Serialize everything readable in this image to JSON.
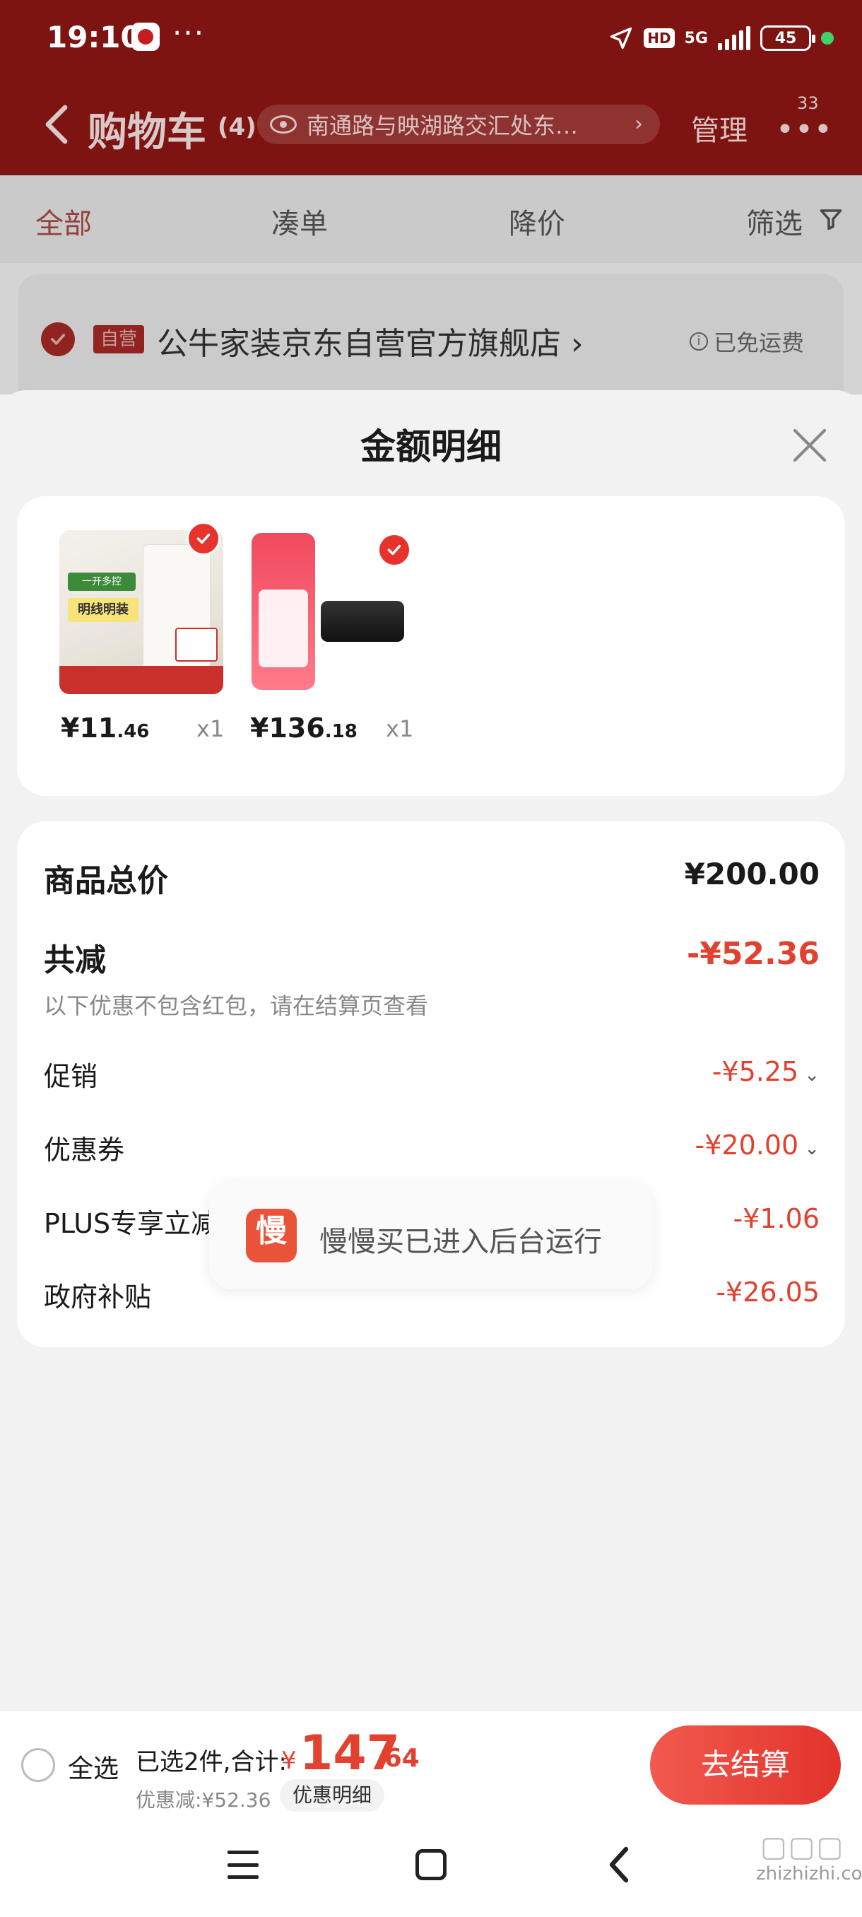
{
  "status_bar": {
    "time": "19:10",
    "dots": "···",
    "hd": "HD",
    "network": "5G",
    "battery": "45"
  },
  "header": {
    "title": "购物车",
    "count": "(4)",
    "address": "南通路与映湖路交汇处东…",
    "manage": "管理",
    "more_badge": "33"
  },
  "tabs": [
    {
      "label": "全部"
    },
    {
      "label": "凑单"
    },
    {
      "label": "降价"
    },
    {
      "label": "筛选"
    }
  ],
  "store": {
    "tag": "自营",
    "name": "公牛家装京东自营官方旗舰店 ›",
    "shipping": "已免运费"
  },
  "sheet": {
    "title": "金额明细",
    "products": [
      {
        "price_int": "¥11",
        "price_dec": ".46",
        "qty": "x1"
      },
      {
        "price_int": "¥136",
        "price_dec": ".18",
        "qty": "x1"
      }
    ],
    "product1_badge": "一开多控",
    "product1_label": "明线明装",
    "summary": {
      "total_label": "商品总价",
      "total_value": "¥200.00",
      "reduce_label": "共减",
      "reduce_value": "-¥52.36",
      "note": "以下优惠不包含红包，请在结算页查看",
      "items": [
        {
          "label": "促销",
          "value": "-¥5.25"
        },
        {
          "label": "优惠券",
          "value": "-¥20.00"
        },
        {
          "label": "PLUS专享立减",
          "value": "-¥1.06"
        },
        {
          "label": "政府补贴",
          "value": "-¥26.05"
        }
      ]
    }
  },
  "toast": {
    "logo": "慢",
    "text": "慢慢买已进入后台运行"
  },
  "bottom_bar": {
    "select_all": "全选",
    "selected_text": "已选2件,合计:",
    "currency": "¥",
    "total_int": "147",
    "total_dec": ".64",
    "discount_text": "优惠减:¥52.36",
    "detail_button": "优惠明细",
    "checkout": "去结算"
  },
  "watermark": "zhizhizhi.com",
  "colors": {
    "header_bg": "#7d1411",
    "accent_red": "#e2412f",
    "checkout_start": "#f15a4d",
    "checkout_end": "#e2332c"
  }
}
